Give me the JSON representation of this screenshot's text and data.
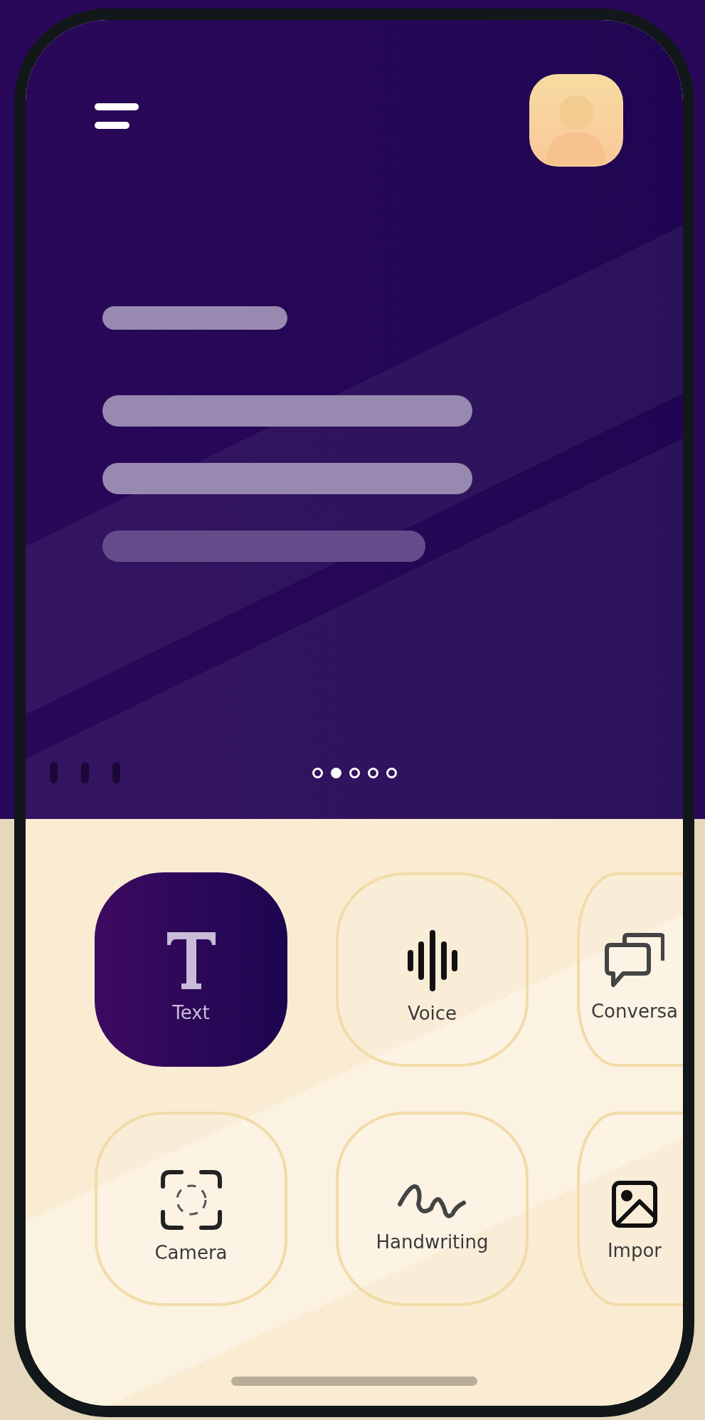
{
  "carousel": {
    "dots": [
      {
        "selected": false
      },
      {
        "selected": true
      },
      {
        "selected": false
      },
      {
        "selected": false
      },
      {
        "selected": false
      }
    ]
  },
  "modes": [
    {
      "label": "Text",
      "kind": "text",
      "selected": true
    },
    {
      "label": "Voice",
      "kind": "voice",
      "selected": false
    },
    {
      "label": "Conversa",
      "kind": "conversation",
      "selected": false
    },
    {
      "label": "Camera",
      "kind": "camera",
      "selected": false
    },
    {
      "label": "Handwriting",
      "kind": "handwriting",
      "selected": false
    },
    {
      "label": "Impor",
      "kind": "import",
      "selected": false
    }
  ]
}
